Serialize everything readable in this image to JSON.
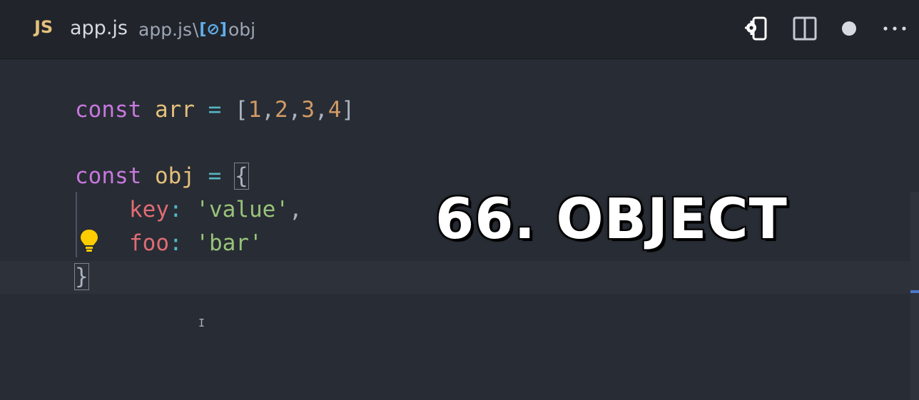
{
  "tab": {
    "language_badge": "JS",
    "file_name": "app.js"
  },
  "breadcrumb": {
    "file": "app.js",
    "separator": "\\",
    "symbol_icon": "[⊘]",
    "symbol": "obj"
  },
  "toolbar": {
    "icons": [
      "open-preview-settings-icon",
      "split-editor-icon",
      "unsaved-dot-icon",
      "more-actions-icon"
    ]
  },
  "code": {
    "line1": {
      "kw": "const",
      "name": "arr",
      "eq": "=",
      "open": "[",
      "values": [
        "1",
        "2",
        "3",
        "4"
      ],
      "comma": ",",
      "close": "]"
    },
    "line3": {
      "kw": "const",
      "name": "obj",
      "eq": "=",
      "open": "{"
    },
    "line4": {
      "key": "key",
      "colon": ":",
      "value": "'value'",
      "comma": ","
    },
    "line5": {
      "key": "foo",
      "colon": ":",
      "value": "'bar'"
    },
    "line6": {
      "close": "}"
    }
  },
  "overlay": {
    "title": "66. OBJECT"
  },
  "colors": {
    "keyword": "#c678dd",
    "variable": "#e5c07b",
    "operator": "#56b6c2",
    "number": "#d19a66",
    "property": "#e06c75",
    "string": "#98c379",
    "background": "#282c34",
    "titlebar": "#21252b"
  }
}
